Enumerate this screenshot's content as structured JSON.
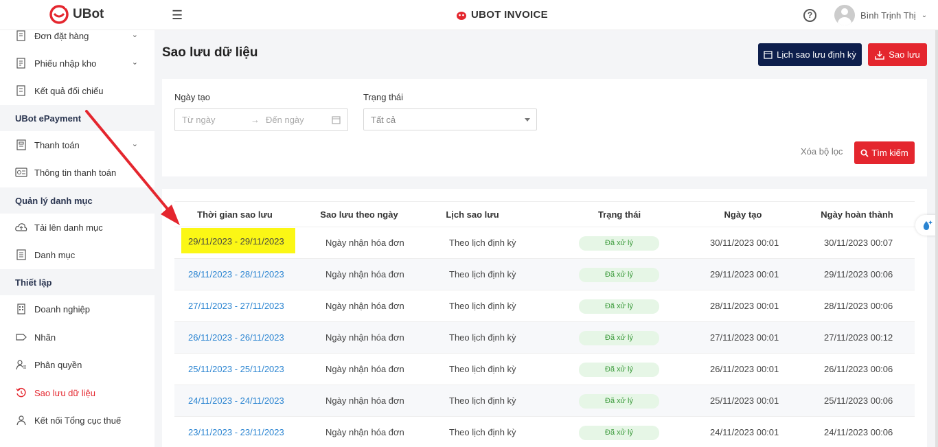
{
  "header": {
    "logo_text": "UBot",
    "center_title": "UBOT INVOICE",
    "user_name": "Bình Trịnh Thị",
    "help_glyph": "?"
  },
  "sidebar": {
    "items": [
      {
        "label": "Đơn đặt hàng",
        "icon": "order-icon",
        "chevron": true
      },
      {
        "label": "Phiếu nhập kho",
        "icon": "receipt-icon",
        "chevron": true
      },
      {
        "label": "Kết quả đối chiếu",
        "icon": "reconcile-icon",
        "chevron": false
      }
    ],
    "section_epayment": "UBot ePayment",
    "epayment_items": [
      {
        "label": "Thanh toán",
        "icon": "payment-icon",
        "chevron": true
      },
      {
        "label": "Thông tin thanh toán",
        "icon": "payment-info-icon",
        "chevron": false
      }
    ],
    "section_catalog": "Quản lý danh mục",
    "catalog_items": [
      {
        "label": "Tải lên danh mục",
        "icon": "upload-cloud-icon"
      },
      {
        "label": "Danh mục",
        "icon": "list-icon"
      }
    ],
    "section_settings": "Thiết lập",
    "settings_items": [
      {
        "label": "Doanh nghiệp",
        "icon": "building-icon"
      },
      {
        "label": "Nhãn",
        "icon": "tag-icon"
      },
      {
        "label": "Phân quyền",
        "icon": "user-permission-icon"
      },
      {
        "label": "Sao lưu dữ liệu",
        "icon": "history-icon",
        "active": true
      },
      {
        "label": "Kết nối Tổng cục thuế",
        "icon": "connect-icon"
      }
    ]
  },
  "page": {
    "title": "Sao lưu dữ liệu",
    "schedule_button": "Lịch sao lưu định kỳ",
    "backup_button": "Sao lưu"
  },
  "filters": {
    "date_label": "Ngày tạo",
    "date_from_placeholder": "Từ ngày",
    "date_to_placeholder": "Đến ngày",
    "status_label": "Trạng thái",
    "status_value": "Tất cả",
    "clear_label": "Xóa bộ lọc",
    "search_label": "Tìm kiếm"
  },
  "table": {
    "columns": [
      "Thời gian sao lưu",
      "Sao lưu theo ngày",
      "Lịch sao lưu",
      "Trạng thái",
      "Ngày tạo",
      "Ngày hoàn thành"
    ],
    "rows": [
      {
        "period": "29/11/2023 - 29/11/2023",
        "by_date": "Ngày nhận hóa đơn",
        "schedule": "Theo lịch định kỳ",
        "status": "Đã xử lý",
        "created": "30/11/2023 00:01",
        "completed": "30/11/2023 00:07",
        "highlighted": true
      },
      {
        "period": "28/11/2023 - 28/11/2023",
        "by_date": "Ngày nhận hóa đơn",
        "schedule": "Theo lịch định kỳ",
        "status": "Đã xử lý",
        "created": "29/11/2023 00:01",
        "completed": "29/11/2023 00:06"
      },
      {
        "period": "27/11/2023 - 27/11/2023",
        "by_date": "Ngày nhận hóa đơn",
        "schedule": "Theo lịch định kỳ",
        "status": "Đã xử lý",
        "created": "28/11/2023 00:01",
        "completed": "28/11/2023 00:06"
      },
      {
        "period": "26/11/2023 - 26/11/2023",
        "by_date": "Ngày nhận hóa đơn",
        "schedule": "Theo lịch định kỳ",
        "status": "Đã xử lý",
        "created": "27/11/2023 00:01",
        "completed": "27/11/2023 00:12"
      },
      {
        "period": "25/11/2023 - 25/11/2023",
        "by_date": "Ngày nhận hóa đơn",
        "schedule": "Theo lịch định kỳ",
        "status": "Đã xử lý",
        "created": "26/11/2023 00:01",
        "completed": "26/11/2023 00:06"
      },
      {
        "period": "24/11/2023 - 24/11/2023",
        "by_date": "Ngày nhận hóa đơn",
        "schedule": "Theo lịch định kỳ",
        "status": "Đã xử lý",
        "created": "25/11/2023 00:01",
        "completed": "25/11/2023 00:06"
      },
      {
        "period": "23/11/2023 - 23/11/2023",
        "by_date": "Ngày nhận hóa đơn",
        "schedule": "Theo lịch định kỳ",
        "status": "Đã xử lý",
        "created": "24/11/2023 00:01",
        "completed": "24/11/2023 00:06"
      }
    ]
  },
  "colors": {
    "brand_red": "#e4262e",
    "navy": "#0d1e4c",
    "link_blue": "#2a84d1",
    "highlight_yellow": "#fbf715",
    "status_green": "#3a9a3a"
  }
}
